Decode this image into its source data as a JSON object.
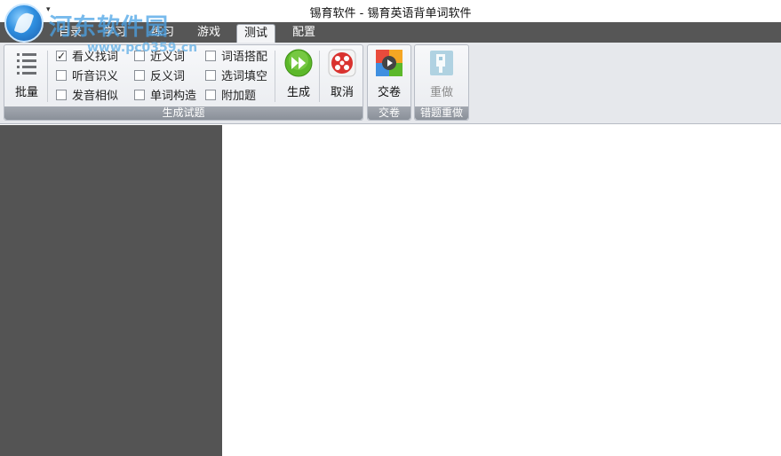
{
  "window": {
    "title": "锡育软件 - 锡育英语背单词软件",
    "qat_arrow": "▾",
    "watermark": "河东软件园",
    "watermark_url": "www.pc0359.cn"
  },
  "tabs": [
    {
      "label": "目录",
      "active": false
    },
    {
      "label": "学习",
      "active": false
    },
    {
      "label": "练习",
      "active": false
    },
    {
      "label": "游戏",
      "active": false
    },
    {
      "label": "测试",
      "active": true
    },
    {
      "label": "配置",
      "active": false
    }
  ],
  "ribbon": {
    "generate_group": {
      "label": "生成试题",
      "batch_button": {
        "label": "批量",
        "icon": "list-icon"
      },
      "options": [
        {
          "label": "看义找词",
          "checked": true
        },
        {
          "label": "听音识义",
          "checked": false
        },
        {
          "label": "发音相似",
          "checked": false
        },
        {
          "label": "近义词",
          "checked": false
        },
        {
          "label": "反义词",
          "checked": false
        },
        {
          "label": "单词构造",
          "checked": false
        },
        {
          "label": "词语搭配",
          "checked": false
        },
        {
          "label": "选词填空",
          "checked": false
        },
        {
          "label": "附加题",
          "checked": false
        }
      ],
      "generate_button": {
        "label": "生成",
        "icon": "fast-forward-icon"
      },
      "cancel_button": {
        "label": "取消",
        "icon": "cancel-icon"
      }
    },
    "submit_group": {
      "label": "交卷",
      "submit_button": {
        "label": "交卷",
        "icon": "submit-paper-icon"
      }
    },
    "redo_group": {
      "label": "错题重做",
      "redo_button": {
        "label": "重做",
        "icon": "redo-icon",
        "disabled": true
      }
    }
  },
  "colors": {
    "tabbar_bg": "#565656",
    "left_pane_bg": "#545454",
    "generate_green": "#5cb82a",
    "cancel_red": "#d9322f"
  }
}
